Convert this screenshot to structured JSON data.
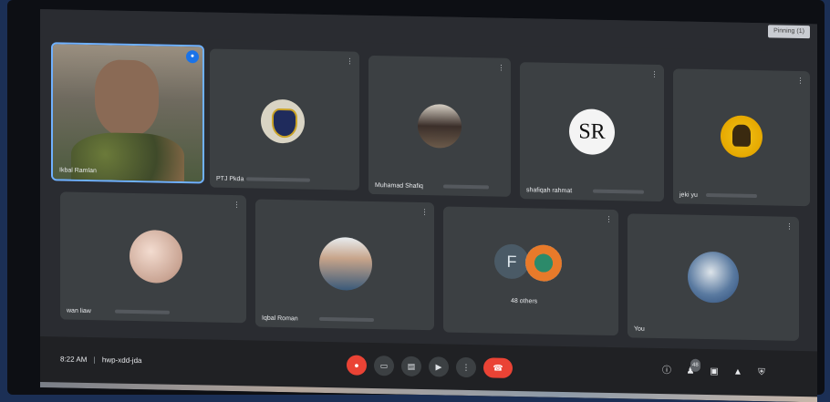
{
  "topbar": {
    "chip_label": "Pinning (1)"
  },
  "tiles": [
    {
      "name": "Ikbal Ramlan",
      "active": true
    },
    {
      "name": "PTJ Pkda"
    },
    {
      "name": "Muhamad Shafiq"
    },
    {
      "name": "shafiqah rahmat",
      "initials": "SR"
    },
    {
      "name": "jeki yu"
    },
    {
      "name": "wan liaw"
    },
    {
      "name": "Iqbal Roman"
    },
    {
      "name": "48 others",
      "initial": "F"
    },
    {
      "name": "You"
    }
  ],
  "controls": {
    "time": "8:22 AM",
    "separator": "|",
    "meeting_code": "hwp-xdd-jda",
    "icons": [
      "mic-off-icon",
      "camera-icon",
      "captions-icon",
      "present-icon",
      "more-icon",
      "end-call-icon"
    ],
    "right_icons": [
      "info-icon",
      "people-icon",
      "chat-icon",
      "activities-icon",
      "host-controls-icon"
    ],
    "participant_count": "48"
  }
}
